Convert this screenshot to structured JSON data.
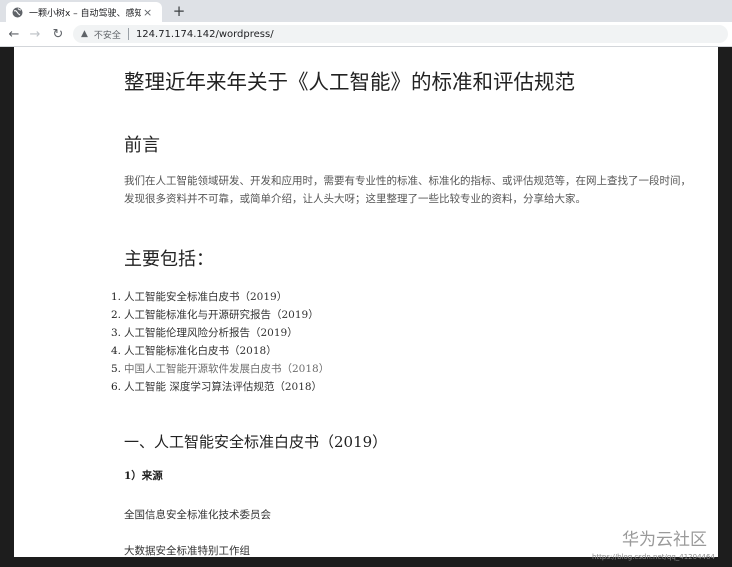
{
  "browser": {
    "tab": {
      "title": "一颗小树x – 自动驾驶、感知识别",
      "favicon": "globe-icon",
      "close": "×"
    },
    "new_tab": "+",
    "nav": {
      "back": "←",
      "forward": "→",
      "reload": "↻"
    },
    "address": {
      "warning_icon": "▲",
      "insecure_label": "不安全",
      "url": "124.71.174.142/wordpress/"
    }
  },
  "article": {
    "title": "整理近年来年关于《人工智能》的标准和评估规范",
    "preface_heading": "前言",
    "preface_text": "我们在人工智能领域研发、开发和应用时，需要有专业性的标准、标准化的指标、或评估规范等，在网上查找了一段时间，发现很多资料并不可靠，或简单介绍，让人头大呀；这里整理了一些比较专业的资料，分享给大家。",
    "main_heading": "主要包括：",
    "toc": [
      {
        "num": "1.",
        "text": "人工智能安全标准白皮书（2019）"
      },
      {
        "num": "2.",
        "text": "人工智能标准化与开源研究报告（2019）"
      },
      {
        "num": "3.",
        "text": "人工智能伦理风险分析报告（2019）"
      },
      {
        "num": "4.",
        "text": "人工智能标准化白皮书（2018）"
      },
      {
        "num": "5.",
        "text": "中国人工智能开源软件发展白皮书（2018）"
      },
      {
        "num": "6.",
        "text": "人工智能 深度学习算法评估规范（2018）"
      }
    ],
    "section1_heading": "一、人工智能安全标准白皮书（2019）",
    "section1_sub": "1）来源",
    "section1_para1": "全国信息安全标准化技术委员会",
    "section1_para2": "大数据安全标准特别工作组"
  },
  "watermark": {
    "logo": "华为云社区",
    "url": "https://blog.csdn.net/qq_41204464"
  }
}
